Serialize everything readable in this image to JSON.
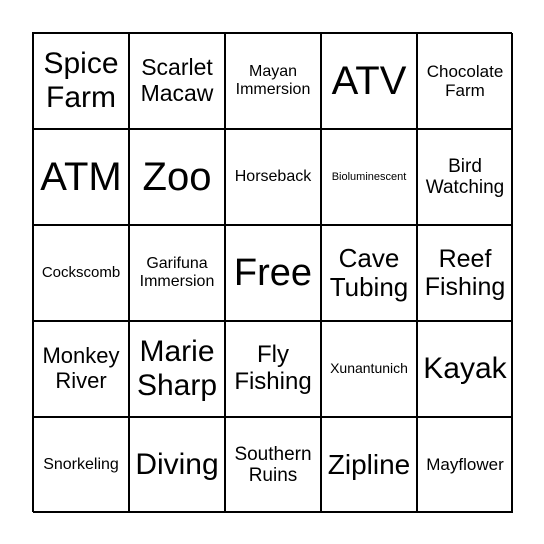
{
  "card": {
    "cells": [
      "Spice Farm",
      "Scarlet Macaw",
      "Mayan Immersion",
      "ATV",
      "Chocolate Farm",
      "ATM",
      "Zoo",
      "Horseback",
      "Bioluminescent",
      "Bird Watching",
      "Cockscomb",
      "Garifuna Immersion",
      "Free",
      "Cave Tubing",
      "Reef Fishing",
      "Monkey River",
      "Marie Sharp",
      "Fly Fishing",
      "Xunantunich",
      "Kayak",
      "Snorkeling",
      "Diving",
      "Southern Ruins",
      "Zipline",
      "Mayflower"
    ]
  }
}
